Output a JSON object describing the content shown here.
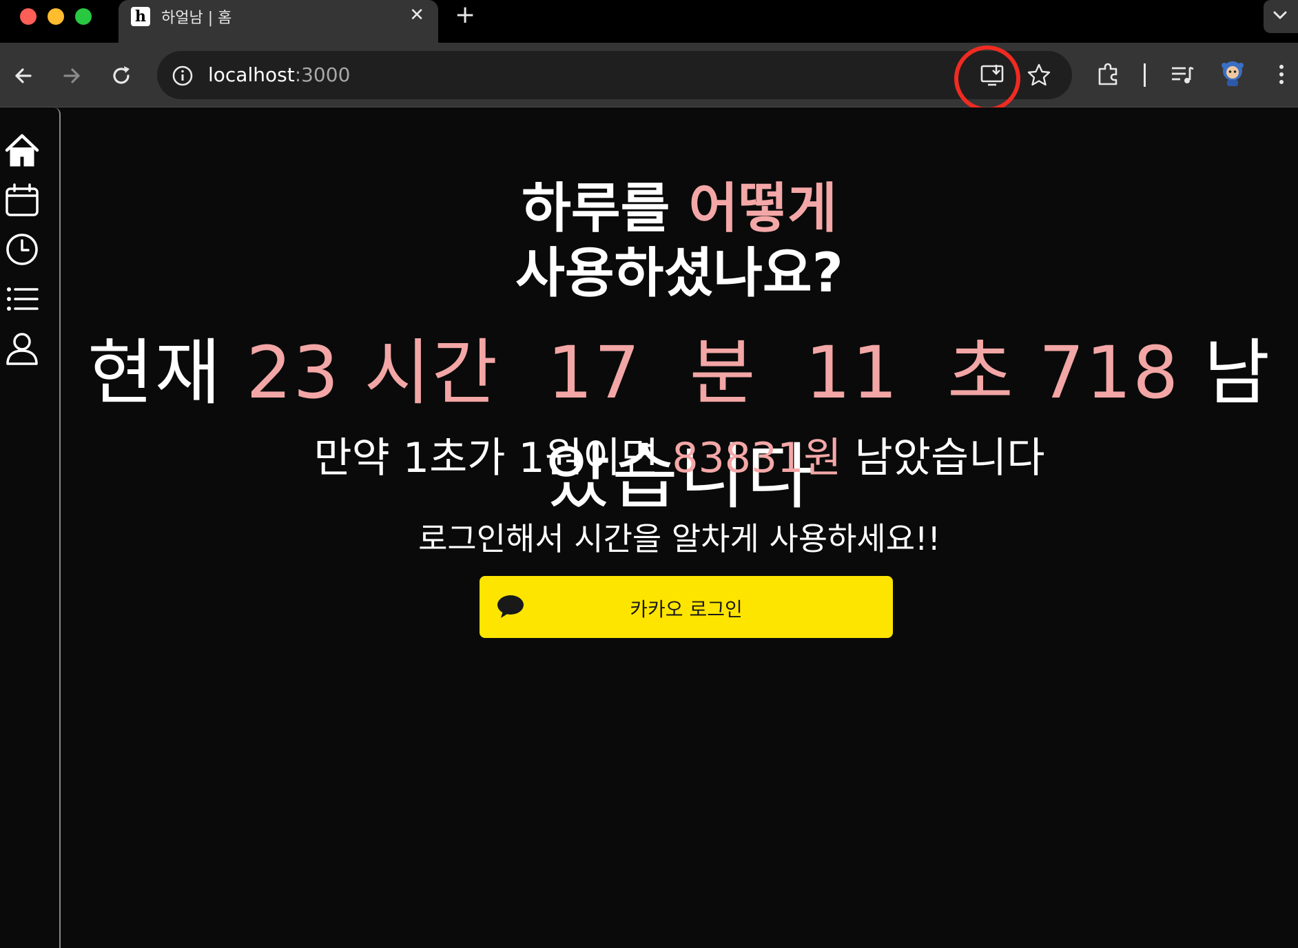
{
  "browser": {
    "tab_title": "하얼남 | 홈",
    "tab_favicon": "h",
    "url_host": "localhost",
    "url_port": ":3000",
    "icons": [
      "back-icon",
      "forward-icon",
      "reload-icon",
      "site-info-icon",
      "install-app-icon",
      "bookmark-star-icon",
      "extensions-icon",
      "media-controls-icon",
      "profile-avatar",
      "menu-icon"
    ]
  },
  "sidebar": {
    "items": [
      "home-icon",
      "calendar-icon",
      "clock-icon",
      "list-icon",
      "user-icon"
    ]
  },
  "hero": {
    "title_line1_prefix": "하루를 ",
    "title_line1_highlight": "어떻게",
    "title_line2": "사용하셨나요?"
  },
  "countdown": {
    "prefix": "현재 ",
    "hours": "23",
    "hours_unit": "시간",
    "minutes": "17",
    "minutes_unit": "분",
    "seconds": "11",
    "seconds_unit": "초",
    "millis": "718",
    "suffix": "남았습니다"
  },
  "money": {
    "prefix": "만약 1초가 1원이면 ",
    "amount": "83831원",
    "suffix": " 남았습니다"
  },
  "cta": {
    "text": "로그인해서 시간을 알차게 사용하세요!!",
    "kakao_label": "카카오 로그인"
  },
  "colors": {
    "accent_pink": "#f4a7a7",
    "kakao_yellow": "#fee500",
    "highlight_ring": "#ef2b22"
  }
}
